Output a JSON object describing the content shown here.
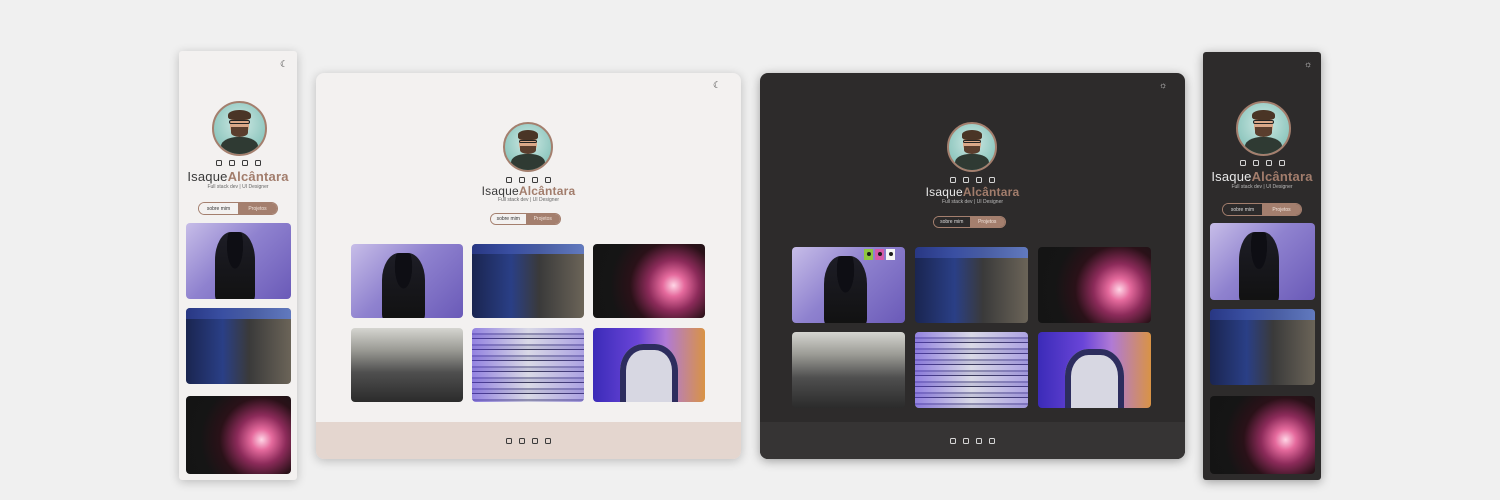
{
  "profile": {
    "first_name": "Isaque",
    "last_name": "Alcântara",
    "role": "Full stack dev | UI Designer",
    "avatar_alt": "avatar"
  },
  "tabs": {
    "about": "sobre mim",
    "projects": "Projetos"
  },
  "theme_toggle": {
    "light_icon": "moon-icon",
    "dark_icon": "sun-icon",
    "moon_glyph": "☾",
    "sun_glyph": "☼"
  },
  "social_icons": [
    "instagram-icon",
    "twitter-icon",
    "linkedin-icon",
    "github-icon"
  ],
  "projects": [
    {
      "name": "vr-headset-photo"
    },
    {
      "name": "datacenter-photo"
    },
    {
      "name": "plasma-ball-photo"
    },
    {
      "name": "office-photo"
    },
    {
      "name": "server-rack-photo"
    },
    {
      "name": "person-shirt-photo"
    }
  ],
  "colors": {
    "accent": "#a47f6e",
    "light_bg": "#f3f1f0",
    "dark_bg": "#2d2b2b",
    "light_footer": "#e4d6cf",
    "dark_footer": "#363434"
  },
  "palette_swatches": [
    "#8ec63f",
    "#d45aa8",
    "#f5f5f5"
  ]
}
